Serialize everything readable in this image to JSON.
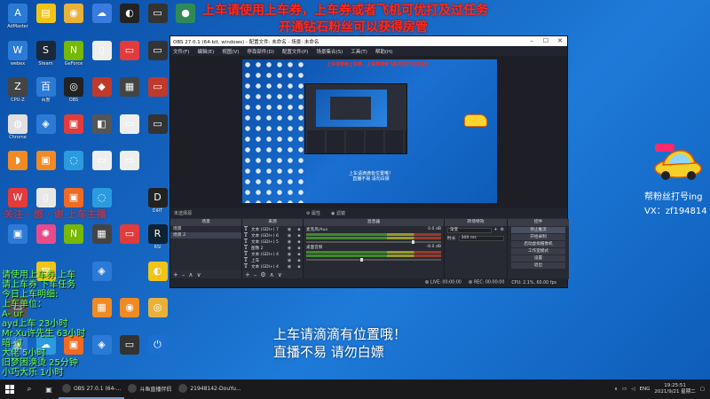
{
  "desktop": {
    "icons": [
      {
        "label": "AdMaster",
        "color": "#2b7bd6",
        "glyph": "A",
        "col": 0,
        "row": 0
      },
      {
        "label": "",
        "color": "#f0c419",
        "glyph": "▤",
        "col": 1,
        "row": 0
      },
      {
        "label": "",
        "color": "#e8b13a",
        "glyph": "◉",
        "col": 2,
        "row": 0
      },
      {
        "label": "",
        "color": "#3a7be0",
        "glyph": "☁",
        "col": 3,
        "row": 0
      },
      {
        "label": "",
        "color": "#222",
        "glyph": "◐",
        "col": 4,
        "row": 0
      },
      {
        "label": "",
        "color": "#333",
        "glyph": "▭",
        "col": 5,
        "row": 0
      },
      {
        "label": "",
        "color": "#2e8b57",
        "glyph": "●",
        "col": 6,
        "row": 0
      },
      {
        "label": "webex",
        "color": "#2b7bd6",
        "glyph": "W",
        "col": 0,
        "row": 1
      },
      {
        "label": "Steam",
        "color": "#1b2838",
        "glyph": "S",
        "col": 1,
        "row": 1
      },
      {
        "label": "GeForce",
        "color": "#76b900",
        "glyph": "N",
        "col": 2,
        "row": 1
      },
      {
        "label": "",
        "color": "#eee",
        "glyph": "▯",
        "col": 3,
        "row": 1
      },
      {
        "label": "",
        "color": "#e23b3b",
        "glyph": "▭",
        "col": 4,
        "row": 1
      },
      {
        "label": "",
        "color": "#333",
        "glyph": "▭",
        "col": 5,
        "row": 1
      },
      {
        "label": "CPU-Z",
        "color": "#444",
        "glyph": "Z",
        "col": 0,
        "row": 2
      },
      {
        "label": "百度",
        "color": "#2b7bd6",
        "glyph": "百",
        "col": 1,
        "row": 2
      },
      {
        "label": "OBS",
        "color": "#222",
        "glyph": "◎",
        "col": 2,
        "row": 2
      },
      {
        "label": "",
        "color": "#c0392b",
        "glyph": "◆",
        "col": 3,
        "row": 2
      },
      {
        "label": "",
        "color": "#444",
        "glyph": "▦",
        "col": 4,
        "row": 2
      },
      {
        "label": "",
        "color": "#c0392b",
        "glyph": "▭",
        "col": 5,
        "row": 2
      },
      {
        "label": "Chrome",
        "color": "#e0e0e0",
        "glyph": "◍",
        "col": 0,
        "row": 3
      },
      {
        "label": "",
        "color": "#2b7bd6",
        "glyph": "◈",
        "col": 1,
        "row": 3
      },
      {
        "label": "",
        "color": "#e23b3b",
        "glyph": "▣",
        "col": 2,
        "row": 3
      },
      {
        "label": "",
        "color": "#555",
        "glyph": "◧",
        "col": 3,
        "row": 3
      },
      {
        "label": "",
        "color": "#eee",
        "glyph": "▭",
        "col": 4,
        "row": 3
      },
      {
        "label": "",
        "color": "#333",
        "glyph": "▭",
        "col": 5,
        "row": 3
      },
      {
        "label": "",
        "color": "#f08a24",
        "glyph": "◗",
        "col": 0,
        "row": 4
      },
      {
        "label": "",
        "color": "#f08a24",
        "glyph": "▣",
        "col": 1,
        "row": 4
      },
      {
        "label": "",
        "color": "#2b9be0",
        "glyph": "◌",
        "col": 2,
        "row": 4
      },
      {
        "label": "",
        "color": "#eee",
        "glyph": "▭",
        "col": 3,
        "row": 4
      },
      {
        "label": "",
        "color": "#eee",
        "glyph": "▭",
        "col": 4,
        "row": 4
      },
      {
        "label": "",
        "color": "#e23b3b",
        "glyph": "W",
        "col": 0,
        "row": 5
      },
      {
        "label": "",
        "color": "#e8e8e8",
        "glyph": "▯",
        "col": 1,
        "row": 5
      },
      {
        "label": "",
        "color": "#f06a24",
        "glyph": "▣",
        "col": 2,
        "row": 5
      },
      {
        "label": "",
        "color": "#2b9be0",
        "glyph": "◌",
        "col": 3,
        "row": 5
      },
      {
        "label": "DiRT",
        "color": "#222",
        "glyph": "D",
        "col": 5,
        "row": 5
      },
      {
        "label": "",
        "color": "#2b7bd6",
        "glyph": "▣",
        "col": 0,
        "row": 6
      },
      {
        "label": "",
        "color": "#e94b8a",
        "glyph": "✺",
        "col": 1,
        "row": 6
      },
      {
        "label": "",
        "color": "#76b900",
        "glyph": "N",
        "col": 2,
        "row": 6
      },
      {
        "label": "",
        "color": "#444",
        "glyph": "▦",
        "col": 3,
        "row": 6
      },
      {
        "label": "",
        "color": "#e23b3b",
        "glyph": "▭",
        "col": 4,
        "row": 6
      },
      {
        "label": "RSI",
        "color": "#123",
        "glyph": "R",
        "col": 5,
        "row": 6
      },
      {
        "label": "",
        "color": "#f0c419",
        "glyph": "▤",
        "col": 1,
        "row": 7
      },
      {
        "label": "",
        "color": "#2b7bd6",
        "glyph": "◈",
        "col": 3,
        "row": 7
      },
      {
        "label": "",
        "color": "#f0c419",
        "glyph": "◐",
        "col": 5,
        "row": 7
      },
      {
        "label": "",
        "color": "#555",
        "glyph": "▭",
        "col": 0,
        "row": 8
      },
      {
        "label": "",
        "color": "#f08a24",
        "glyph": "▦",
        "col": 3,
        "row": 8
      },
      {
        "label": "",
        "color": "#f08a24",
        "glyph": "◉",
        "col": 4,
        "row": 8
      },
      {
        "label": "",
        "color": "#e8b13a",
        "glyph": "◎",
        "col": 5,
        "row": 8
      },
      {
        "label": "",
        "color": "#2b7bd6",
        "glyph": "▣",
        "col": 0,
        "row": 9
      },
      {
        "label": "",
        "color": "#2b9be0",
        "glyph": "☁",
        "col": 1,
        "row": 9
      },
      {
        "label": "",
        "color": "#f06a24",
        "glyph": "▣",
        "col": 2,
        "row": 9
      },
      {
        "label": "",
        "color": "#2b7bd6",
        "glyph": "◈",
        "col": 3,
        "row": 9
      },
      {
        "label": "",
        "color": "#333",
        "glyph": "▭",
        "col": 4,
        "row": 9
      },
      {
        "label": "",
        "color": "#1a6fd0",
        "glyph": "⏻",
        "col": 5,
        "row": 9
      }
    ]
  },
  "overlays": {
    "top_line1": "上车请使用上车券，上车券或者飞机可优打及过任务",
    "top_line2": "开通钻石粉丝可以获得房管",
    "left_red": "关注  · 感    · 谢    上车主播",
    "center_line1": "上车请滴滴有位置哦！",
    "center_line2": "直播不易 请勿白嫖",
    "right_line1": "帮粉丝打号ing",
    "right_line2": "VX：zf194814",
    "green_lines": [
      "请使用上车券 上车",
      "请上车券  下车任务",
      "今日上车明细:",
      "上车单位：",
      "A-  ur",
      "ayd上车 23小时",
      "Mr-Xu许先生 63小时",
      "暗-过",
      "大佬         5小时",
      "旧梦困涣烫     25分钟",
      "小巧大乐     1小时"
    ]
  },
  "obs": {
    "title": "OBS 27.0.1 (64-bit, windows) - 配置文件: 未命名 - 场景: 未命名",
    "menu": [
      "文件(F)",
      "编辑(E)",
      "视图(V)",
      "停靠部件(D)",
      "配置文件(P)",
      "场景集合(S)",
      "工具(T)",
      "帮助(H)"
    ],
    "preview_red": "上车请使用上车券，上车券或者飞机可优打及过任务",
    "preview_white": "上车请滴滴有位置哦！\n直播不易 请勿白嫖",
    "no_source": "未选择源",
    "properties_btn": "⚙ 属性",
    "filters_btn": "◉ 滤镜",
    "docks": {
      "scenes": {
        "header": "场景",
        "items": [
          "场景",
          "场景 2"
        ]
      },
      "sources": {
        "header": "来源",
        "items": [
          "文本 (GDI+) 7",
          "文本 (GDI+) 6",
          "文本 (GDI+) 5",
          "图像 2",
          "文本 (GDI+) 4",
          "上车",
          "文本 (GDI+) 4"
        ]
      },
      "mixer": {
        "header": "混音器",
        "channels": [
          {
            "name": "麦克风/Aux",
            "level": "0.0 dB"
          },
          {
            "name": "桌面音频",
            "level": "-8.0 dB"
          }
        ]
      },
      "transitions": {
        "header": "转场特效",
        "type": "渐变",
        "duration_label": "时长",
        "duration": "300 ms"
      },
      "controls": {
        "header": "控件",
        "buttons": [
          "停止推流",
          "开始录制",
          "启动虚拟摄像机",
          "工作室模式",
          "设置",
          "退出"
        ]
      }
    },
    "status": {
      "live": "LIVE: 00:00:00",
      "rec": "REC: 00:00:00",
      "cpu": "CPU: 2.1%, 60.00 fps"
    }
  },
  "taskbar": {
    "tasks": [
      {
        "label": "OBS 27.0.1 (64-...",
        "active": true
      },
      {
        "label": "斗鱼直播伴侣",
        "active": false
      },
      {
        "label": "21948142-DouYu...",
        "active": false
      }
    ],
    "lang": "ENG",
    "time": "19:25:51",
    "date": "2021/9/21 星期二"
  }
}
